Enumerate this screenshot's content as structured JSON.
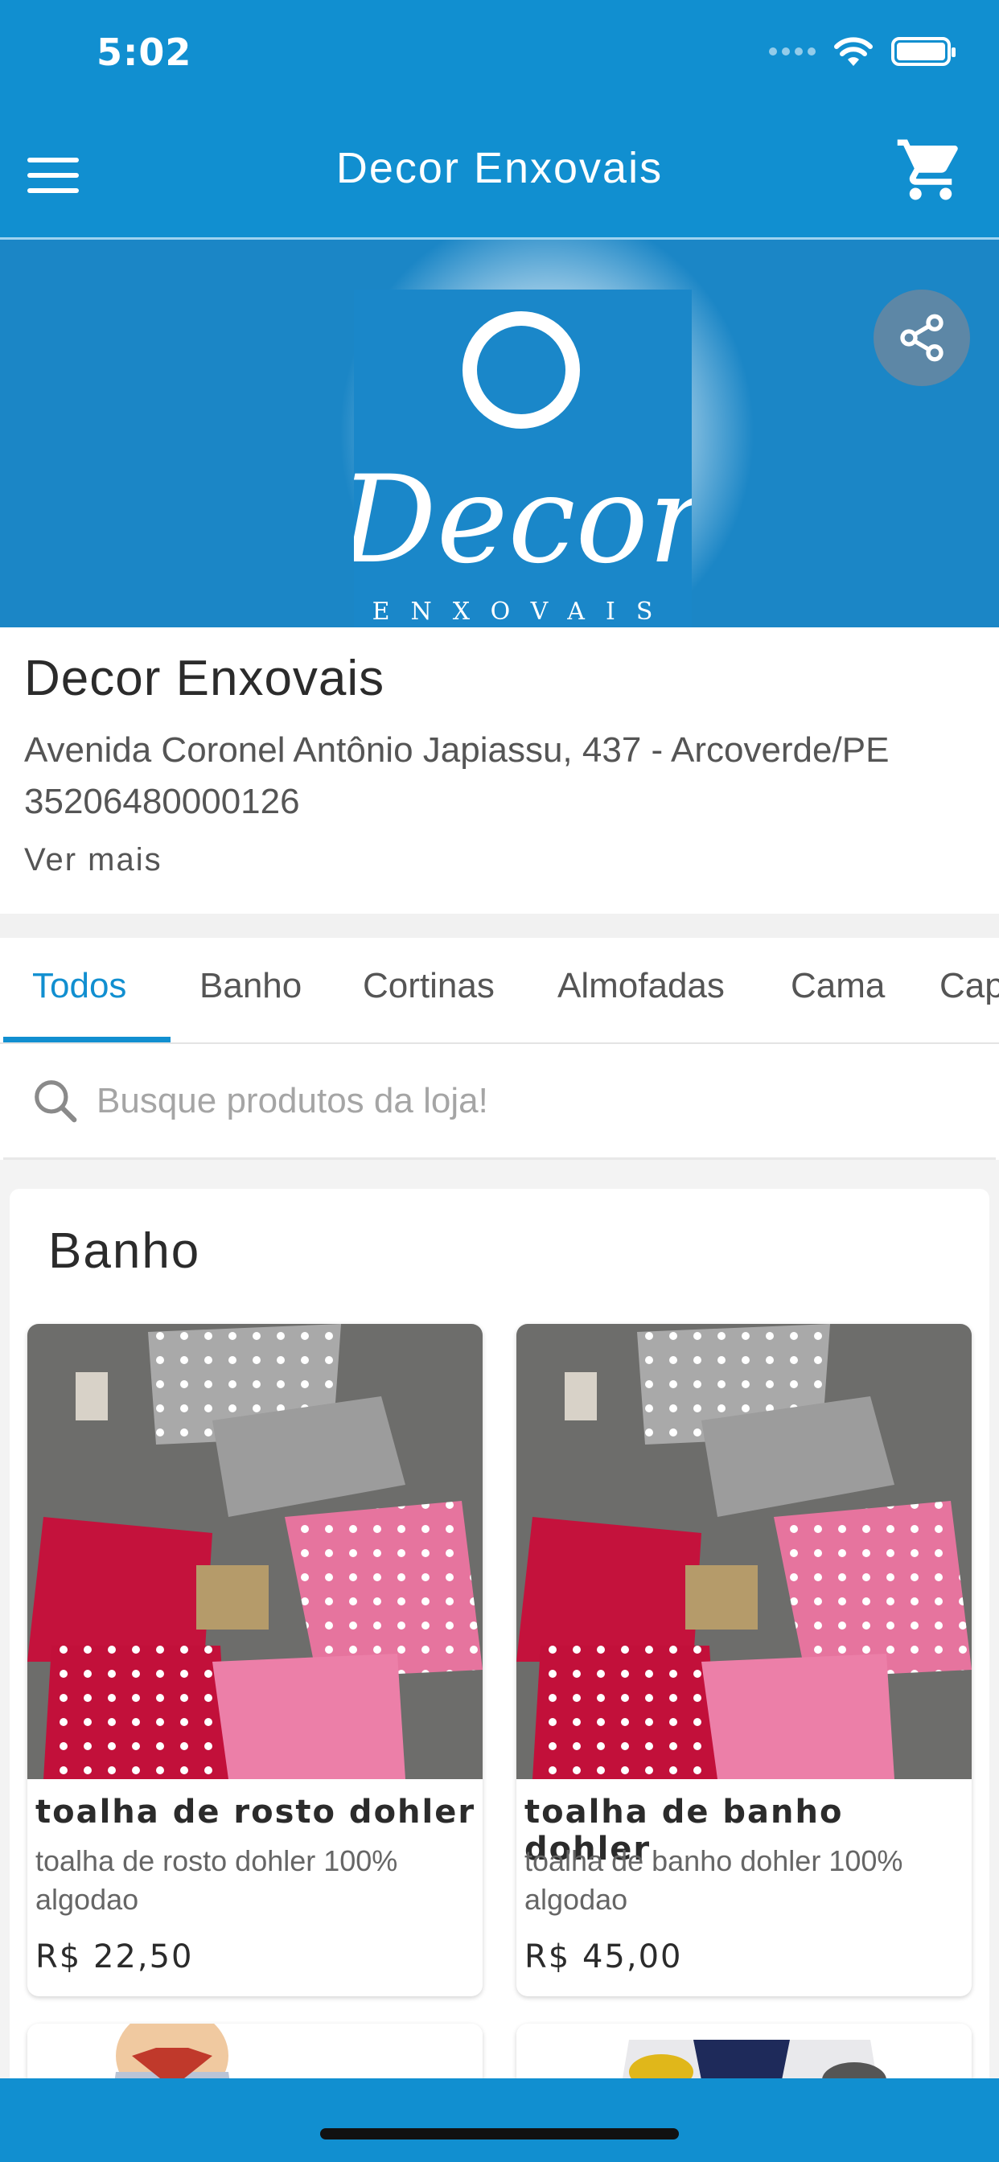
{
  "status_bar": {
    "time": "5:02"
  },
  "app_bar": {
    "title": "Decor Enxovais"
  },
  "hero": {
    "logo_word": "Decor",
    "logo_subword": "ENXOVAIS"
  },
  "store": {
    "name": "Decor Enxovais",
    "address": "Avenida Coronel Antônio Japiassu, 437 - Arcoverde/PE",
    "cnpj": "35206480000126",
    "more_label": "Ver mais"
  },
  "tabs": [
    {
      "label": "Todos",
      "active": true
    },
    {
      "label": "Banho",
      "active": false
    },
    {
      "label": "Cortinas",
      "active": false
    },
    {
      "label": "Almofadas",
      "active": false
    },
    {
      "label": "Cama",
      "active": false
    },
    {
      "label": "Cap",
      "active": false
    }
  ],
  "search": {
    "placeholder": "Busque produtos da loja!"
  },
  "section": {
    "title": "Banho"
  },
  "products": [
    {
      "name": "toalha de rosto dohler",
      "description": "toalha de rosto dohler 100% algodao",
      "price": "R$ 22,50"
    },
    {
      "name": "toalha de banho dohler",
      "description": "toalha de banho dohler 100% algodao",
      "price": "R$ 45,00"
    }
  ],
  "colors": {
    "primary": "#118fd0",
    "banner": "#1b86c6",
    "share_button": "#5d87a6"
  }
}
